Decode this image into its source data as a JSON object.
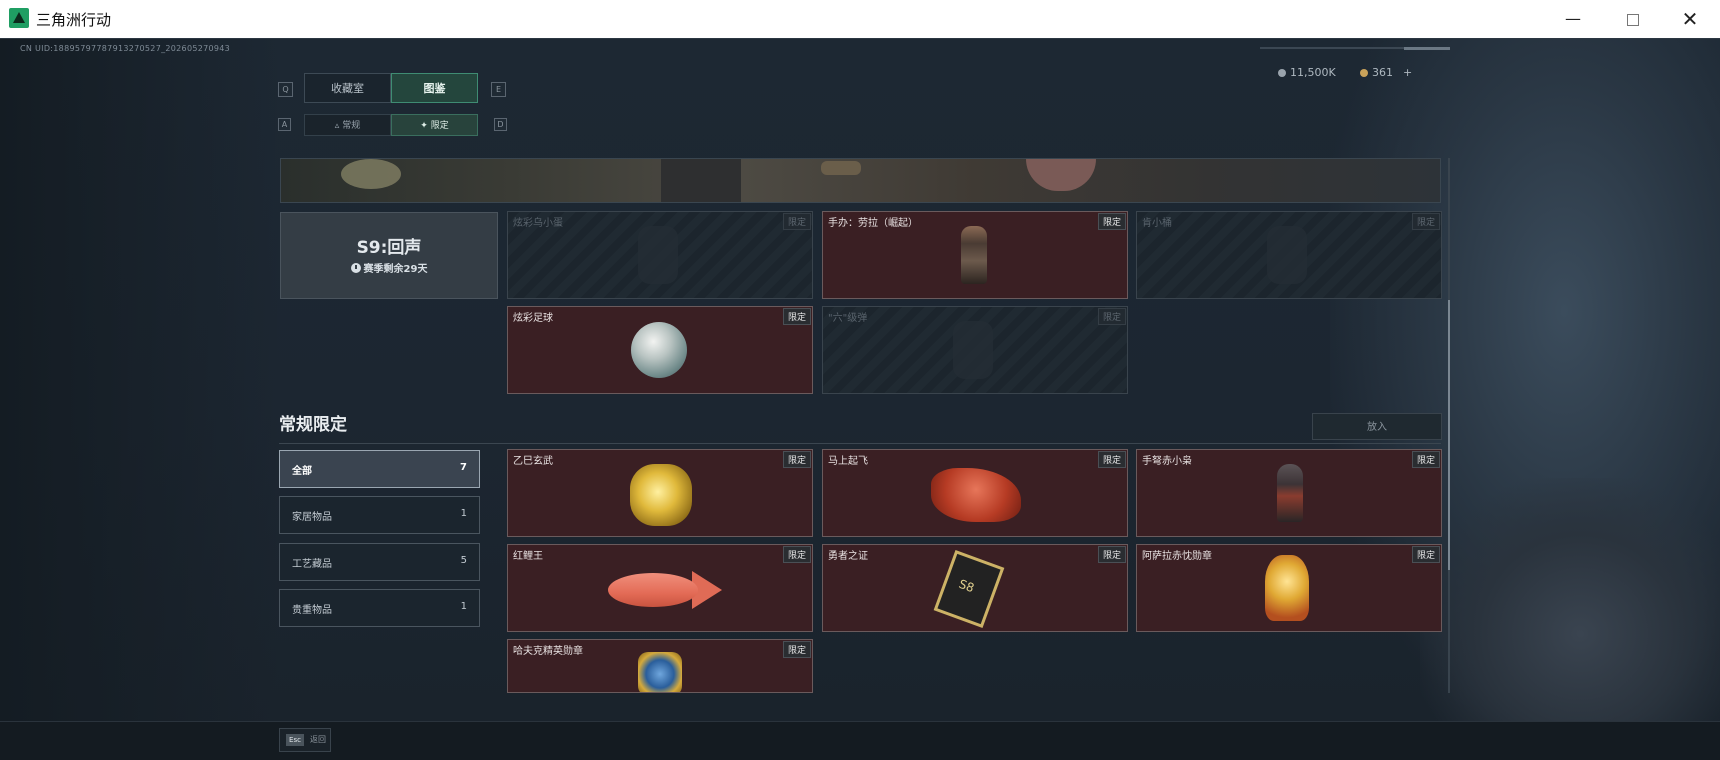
{
  "window": {
    "title": "三角洲行动",
    "minimize": "—",
    "close": "✕"
  },
  "uid": "CN UID:188957977879132705​27_202605270943",
  "keys": {
    "tab_left": "Q",
    "tab_right": "E",
    "sub_left": "A",
    "sub_right": "D"
  },
  "tabs": [
    {
      "label": "收藏室"
    },
    {
      "label": "图鉴"
    }
  ],
  "subtabs": [
    {
      "label": "常规"
    },
    {
      "label": "限定"
    }
  ],
  "currency": {
    "coins": "11,500K",
    "tickets": "361",
    "plus": "+",
    "coin_color": "#9aa4ad",
    "ticket_color": "#c9a25a"
  },
  "season": {
    "title": "S9:回声",
    "remaining": "赛季剩余29天"
  },
  "top_cards": [
    {
      "name": "炫彩乌小蛋",
      "badge": "限定",
      "locked": true,
      "art": "ghost-icon"
    },
    {
      "name": "手办：劳拉（崛起）",
      "badge": "限定",
      "locked": false,
      "art": "figure-icon"
    },
    {
      "name": "肯小桶",
      "badge": "限定",
      "locked": true,
      "art": "ghost-icon"
    },
    {
      "name": "炫彩足球",
      "badge": "限定",
      "locked": false,
      "art": "ball-icon"
    },
    {
      "name": "\"六\"级弹",
      "badge": "限定",
      "locked": true,
      "art": "ghost-icon"
    }
  ],
  "section": {
    "title": "常规限定",
    "put_in": "放入"
  },
  "categories": [
    {
      "label": "全部",
      "count": "7"
    },
    {
      "label": "家居物品",
      "count": "1"
    },
    {
      "label": "工艺藏品",
      "count": "5"
    },
    {
      "label": "贵重物品",
      "count": "1"
    }
  ],
  "items": [
    {
      "name": "乙巳玄武",
      "badge": "限定"
    },
    {
      "name": "马上起飞",
      "badge": "限定"
    },
    {
      "name": "手弩赤小枭",
      "badge": "限定"
    },
    {
      "name": "红鲤王",
      "badge": "限定"
    },
    {
      "name": "勇者之证",
      "badge": "限定",
      "mark": "S8"
    },
    {
      "name": "阿萨拉赤忱勋章",
      "badge": "限定"
    },
    {
      "name": "哈夫克精英勋章",
      "badge": "限定"
    }
  ],
  "footer": {
    "key": "Esc",
    "label": "返回"
  }
}
